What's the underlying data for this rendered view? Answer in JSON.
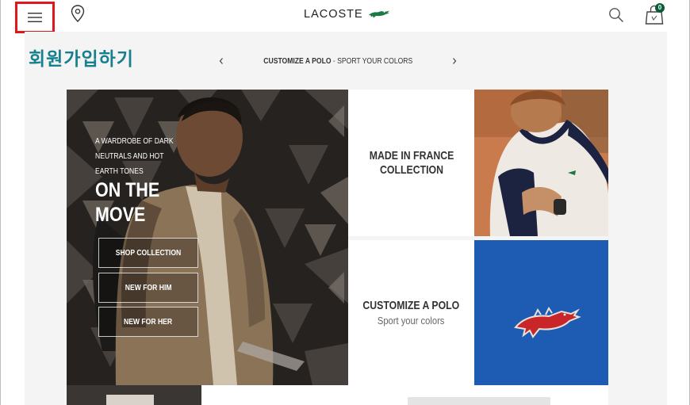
{
  "header": {
    "logo_text": "LACOSTE",
    "bag_count": "0"
  },
  "signup": {
    "label": "회원가입하기"
  },
  "promo": {
    "bold": "CUSTOMIZE A POLO",
    "separator": " - ",
    "rest": "SPORT YOUR COLORS"
  },
  "hero": {
    "tagline": "A WARDROBE OF DARK NEUTRALS AND HOT EARTH TONES",
    "title": "ON THE MOVE",
    "buttons": [
      "SHOP COLLECTION",
      "NEW FOR HIM",
      "NEW FOR HER"
    ]
  },
  "tiles": {
    "france": {
      "heading": "MADE IN FRANCE COLLECTION"
    },
    "polo": {
      "heading": "CUSTOMIZE A POLO",
      "sub": "Sport your colors"
    }
  },
  "colors": {
    "accent_green": "#0a5c36",
    "signup_teal": "#17808e",
    "highlight_red": "#e0161d"
  }
}
